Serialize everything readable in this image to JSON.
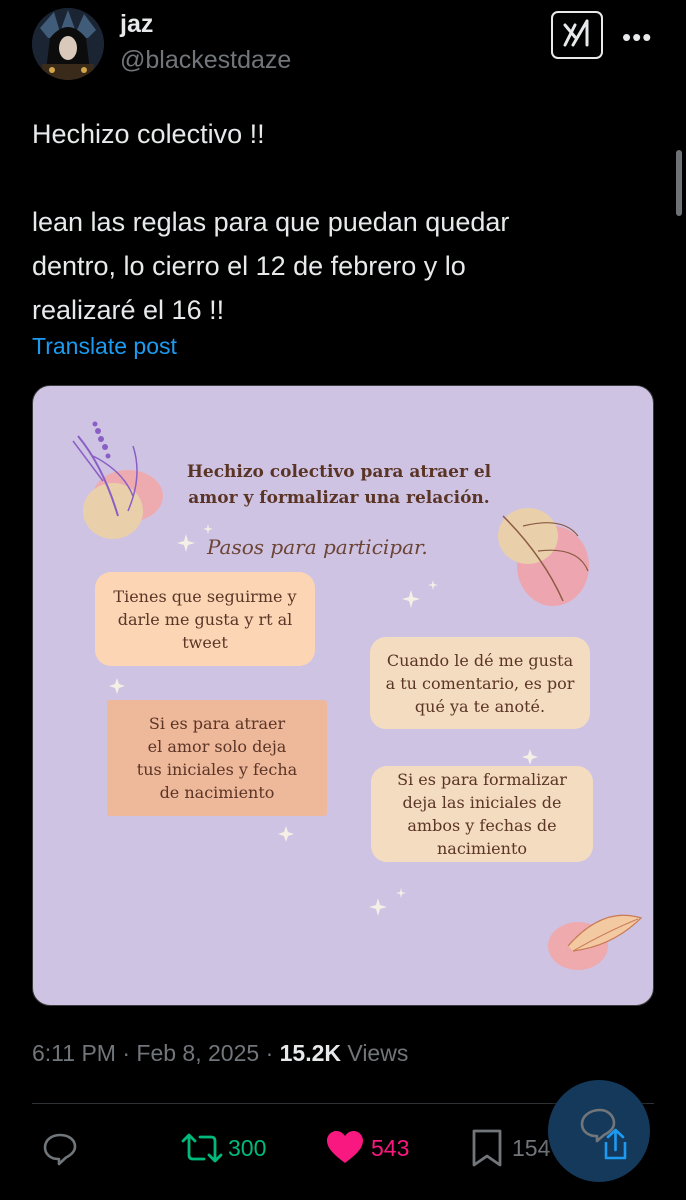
{
  "author": {
    "display_name": "jaz",
    "handle": "@blackestdaze"
  },
  "header": {
    "grok_icon": "grok-icon",
    "more_icon": "more-horizontal-icon",
    "more_label": "•••"
  },
  "tweet": {
    "text": "Hechizo colectivo !!\n\nlean las reglas para que puedan quedar\ndentro, lo cierro el 12 de febrero y lo\nrealizaré el 16 !!",
    "translate_label": "Translate post"
  },
  "media": {
    "title": "Hechizo colectivo para atraer el\namor y formalizar una relación.",
    "subtitle": "Pasos para participar.",
    "cards": [
      "Tienes que seguirme y\ndarle me gusta y rt al\ntweet",
      "Cuando le dé me gusta\na tu comentario, es por\nqué ya te anoté.",
      "Si es para atraer\nel amor solo deja\ntus iniciales y fecha\nde nacimiento",
      "Si es para formalizar\ndeja las iniciales de\nambos y fechas de\nnacimiento"
    ],
    "colors": {
      "background": "#cfc3e4",
      "text": "#5a3425"
    }
  },
  "meta": {
    "time": "6:11 PM",
    "separator": "·",
    "date": "Feb 8, 2025",
    "views_count": "15.2K",
    "views_label": "Views"
  },
  "actions": {
    "reply_icon": "reply-icon",
    "retweet_count": "300",
    "like_count": "543",
    "bookmark_count": "154",
    "colors": {
      "retweet": "#00ba7c",
      "like": "#f91880",
      "muted": "#71767b"
    }
  },
  "fab": {
    "icon": "reply-share-icon"
  }
}
